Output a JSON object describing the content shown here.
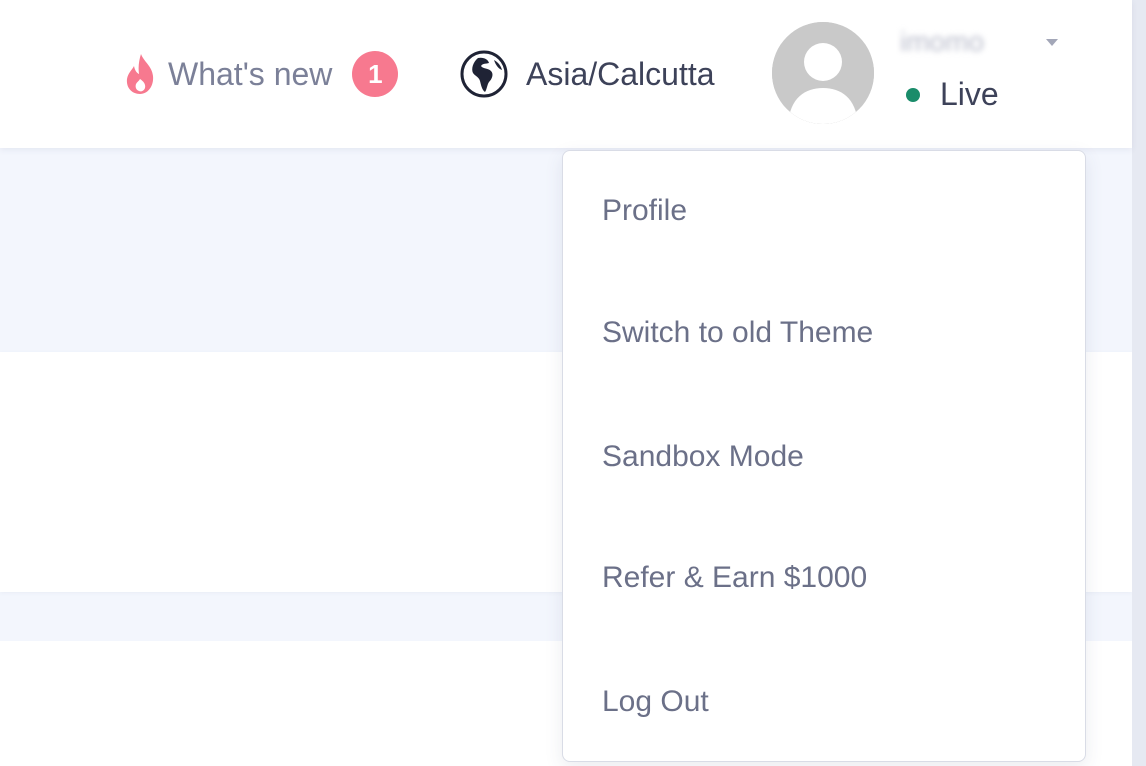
{
  "header": {
    "whats_new": {
      "label": "What's new",
      "badge_count": "1",
      "icon": "flame-icon",
      "accent_color": "#f7798f"
    },
    "timezone": {
      "label": "Asia/Calcutta",
      "icon": "globe-icon"
    },
    "user": {
      "name": "imomo",
      "avatar_icon": "default-user-avatar",
      "status_label": "Live",
      "status_color": "#1a8c6a"
    }
  },
  "user_menu": {
    "items": [
      {
        "label": "Profile"
      },
      {
        "label": "Switch to old Theme"
      },
      {
        "label": "Sandbox Mode"
      },
      {
        "label": "Refer & Earn $1000"
      },
      {
        "label": "Log Out"
      }
    ]
  },
  "colors": {
    "page_background": "#f3f6fd",
    "header_background": "#ffffff",
    "menu_text": "#6b7088",
    "primary_text": "#3d4259"
  }
}
